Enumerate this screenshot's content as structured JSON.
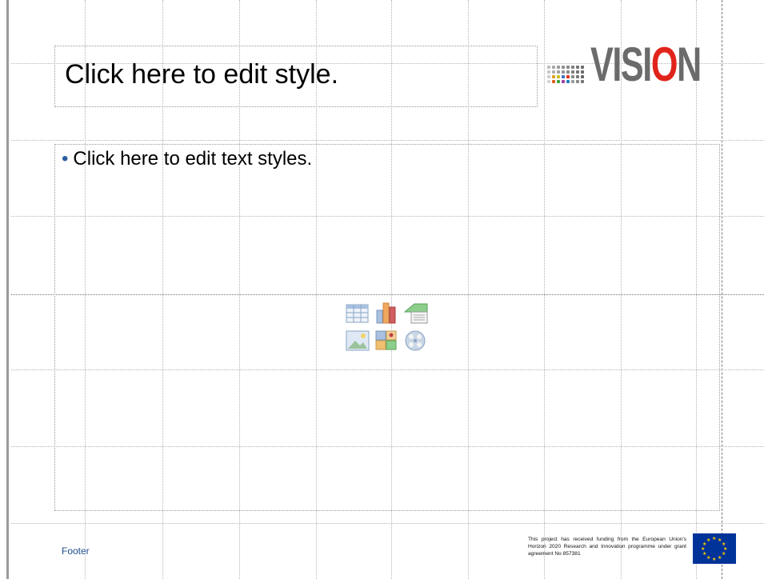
{
  "slide": {
    "title_placeholder": "Click here to edit style.",
    "body_placeholder": "Click here to edit text styles.",
    "bullet": "•",
    "footer": "Footer",
    "funding_text": "This project has received funding from the European Union's Horizon 2020 Research and Innovation programme under grant agreement No 857381"
  },
  "logo": {
    "word_prefix": "VISI",
    "word_highlight": "O",
    "word_suffix": "N",
    "colors": {
      "grey": "#6b6b6b",
      "red": "#e1241b"
    }
  },
  "content_icons": [
    "insert-table-icon",
    "insert-chart-icon",
    "insert-smartart-icon",
    "insert-picture-icon",
    "insert-clipart-icon",
    "insert-media-icon"
  ],
  "colors": {
    "guides": "#b5b5b5",
    "footer_text": "#1f4e8c",
    "bullet": "#2c5f9e",
    "eu_blue": "#003399",
    "eu_star": "#ffcc00"
  }
}
